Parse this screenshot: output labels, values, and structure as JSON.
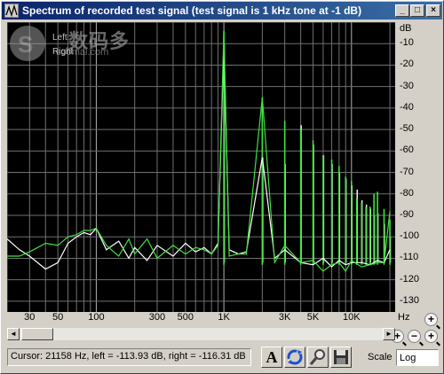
{
  "window": {
    "title": "Spectrum of recorded test signal (test signal is 1 kHz tone at -1 dB)",
    "controls": {
      "minimize": "_",
      "maximize": "□",
      "close": "×"
    }
  },
  "watermark": {
    "chinese": "数码多",
    "url": "soomal.com",
    "logo_letter": "S"
  },
  "legend": {
    "left": "Left",
    "right": "Right"
  },
  "axis": {
    "y_unit": "dB",
    "y_ticks": [
      "-10",
      "-20",
      "-30",
      "-40",
      "-50",
      "-60",
      "-70",
      "-80",
      "-90",
      "-100",
      "-110",
      "-120",
      "-130"
    ],
    "x_ticks": [
      "30",
      "50",
      "100",
      "300",
      "500",
      "1K",
      "3K",
      "5K",
      "10K"
    ],
    "x_unit": "Hz"
  },
  "chart_data": {
    "type": "line",
    "x_scale": "log",
    "xlim": [
      20,
      22000
    ],
    "ylim": [
      -135,
      0
    ],
    "ylabel": "dB",
    "xlabel": "Hz",
    "grid": true,
    "series": [
      {
        "name": "Left",
        "color": "#40e040",
        "x": [
          20,
          25,
          30,
          40,
          50,
          60,
          70,
          80,
          90,
          100,
          120,
          150,
          180,
          200,
          250,
          300,
          400,
          500,
          600,
          700,
          800,
          900,
          1000,
          1100,
          1300,
          1500,
          2000,
          2500,
          3000,
          4000,
          5000,
          6000,
          7000,
          8000,
          9000,
          10000,
          12000,
          14000,
          16000,
          18000,
          20000
        ],
        "y": [
          -109,
          -109,
          -107,
          -103,
          -104,
          -100,
          -99,
          -97,
          -97,
          -96,
          -104,
          -109,
          -101,
          -108,
          -101,
          -110,
          -104,
          -108,
          -105,
          -106,
          -108,
          -104,
          -4,
          -109,
          -108,
          -108,
          -35,
          -112,
          -104,
          -112,
          -111,
          -116,
          -113,
          -112,
          -116,
          -111,
          -114,
          -113,
          -112,
          -112,
          -88
        ]
      },
      {
        "name": "Right",
        "color": "#ffffff",
        "x": [
          20,
          25,
          30,
          40,
          50,
          60,
          70,
          80,
          90,
          100,
          120,
          150,
          180,
          200,
          250,
          300,
          400,
          500,
          600,
          700,
          800,
          900,
          1000,
          1100,
          1300,
          1500,
          2000,
          2500,
          3000,
          4000,
          5000,
          6000,
          7000,
          8000,
          9000,
          10000,
          12000,
          14000,
          16000,
          18000,
          20000
        ],
        "y": [
          -101,
          -106,
          -109,
          -115,
          -112,
          -103,
          -100,
          -98,
          -99,
          -96,
          -106,
          -102,
          -110,
          -105,
          -111,
          -104,
          -109,
          -103,
          -107,
          -105,
          -108,
          -103,
          -10,
          -106,
          -108,
          -107,
          -63,
          -110,
          -106,
          -112,
          -113,
          -110,
          -114,
          -111,
          -113,
          -112,
          -112,
          -113,
          -111,
          -112,
          -106
        ]
      }
    ],
    "peaks": [
      {
        "freq": 1000,
        "left": -4,
        "right": -10
      },
      {
        "freq": 2000,
        "left": -35,
        "right": -63
      },
      {
        "freq": 3000,
        "left": -46,
        "right": -66
      },
      {
        "freq": 4000,
        "left": -50,
        "right": -48
      },
      {
        "freq": 5000,
        "left": -55,
        "right": -57
      },
      {
        "freq": 6000,
        "left": -62,
        "right": -62
      },
      {
        "freq": 7000,
        "left": -64,
        "right": -66
      },
      {
        "freq": 8000,
        "left": -67,
        "right": -70
      },
      {
        "freq": 9000,
        "left": -72,
        "right": -73
      },
      {
        "freq": 10000,
        "left": -74,
        "right": -76
      },
      {
        "freq": 11000,
        "left": -82,
        "right": -78
      },
      {
        "freq": 12000,
        "left": -84,
        "right": -83
      },
      {
        "freq": 13000,
        "left": -86,
        "right": -85
      },
      {
        "freq": 14000,
        "left": -86,
        "right": -87
      },
      {
        "freq": 15000,
        "left": -80,
        "right": -90
      },
      {
        "freq": 16000,
        "left": -79,
        "right": -89
      },
      {
        "freq": 18000,
        "left": -87,
        "right": -94
      },
      {
        "freq": 20000,
        "left": -92,
        "right": -100
      }
    ]
  },
  "scrollbar": {
    "left_arrow": "◄",
    "right_arrow": "►"
  },
  "status": {
    "text": "Cursor:  21158 Hz,  left = -113.93 dB,  right = -116.31 dB"
  },
  "toolbar": {
    "text_tool_label": "A"
  },
  "scale": {
    "label": "Scale",
    "value": "Log"
  },
  "zoom": {
    "in": "+",
    "out": "−"
  }
}
